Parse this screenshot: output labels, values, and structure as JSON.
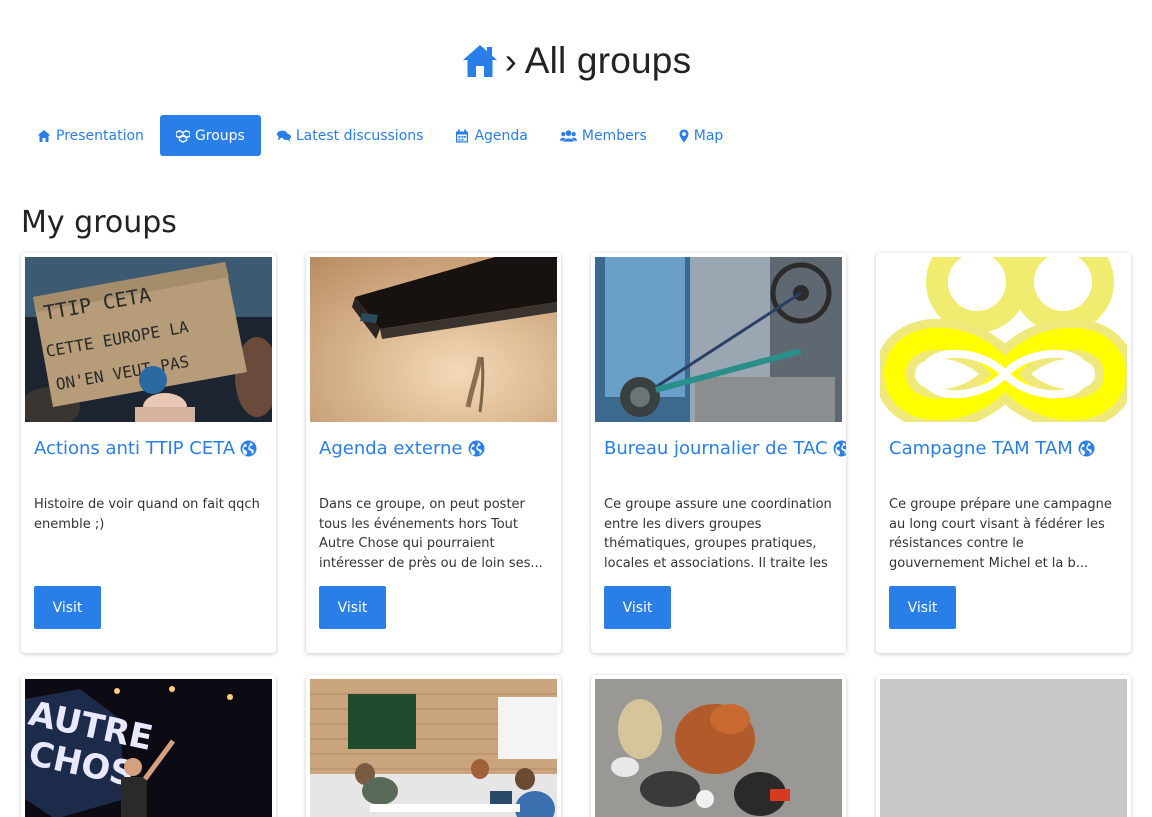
{
  "breadcrumb": {
    "separator": "›",
    "title": "All groups"
  },
  "nav": {
    "tabs": [
      {
        "label": "Presentation",
        "icon": "home-icon",
        "active": false
      },
      {
        "label": "Groups",
        "icon": "cubes-icon",
        "active": true
      },
      {
        "label": "Latest discussions",
        "icon": "comments-icon",
        "active": false
      },
      {
        "label": "Agenda",
        "icon": "calendar-icon",
        "active": false
      },
      {
        "label": "Members",
        "icon": "users-icon",
        "active": false
      },
      {
        "label": "Map",
        "icon": "map-marker-icon",
        "active": false
      }
    ]
  },
  "section": {
    "title": "My groups"
  },
  "colors": {
    "accent": "#2a7ee8",
    "text": "#333333",
    "placeholder": "#c8c8c8"
  },
  "groups": [
    {
      "name": "Actions anti TTIP CETA",
      "description": "Histoire de voir quand on fait qqch enemble ;)",
      "button": "Visit",
      "image": "protest-sign-ttip-ceta"
    },
    {
      "name": "Agenda externe",
      "description": "Dans ce groupe, on peut poster tous les événements hors Tout Autre Chose qui pourraient intéresser de près ou de loin ses...",
      "button": "Visit",
      "image": "black-notebook"
    },
    {
      "name": "Bureau journalier de TAC",
      "description": "Ce groupe assure une coordination entre les divers groupes thématiques, groupes pratiques, locales et associations. Il traite les",
      "button": "Visit",
      "image": "machine-belt"
    },
    {
      "name": "Campagne TAM TAM",
      "description": "Ce groupe prépare une campagne au long court visant à fédérer les résistances contre le gouvernement Michel et la b...",
      "button": "Visit",
      "image": "yellow-infinity-logo"
    },
    {
      "image": "stage-speaker"
    },
    {
      "image": "classroom-meeting"
    },
    {
      "image": "pile-of-objects"
    },
    {
      "image": "grey-placeholder"
    }
  ]
}
